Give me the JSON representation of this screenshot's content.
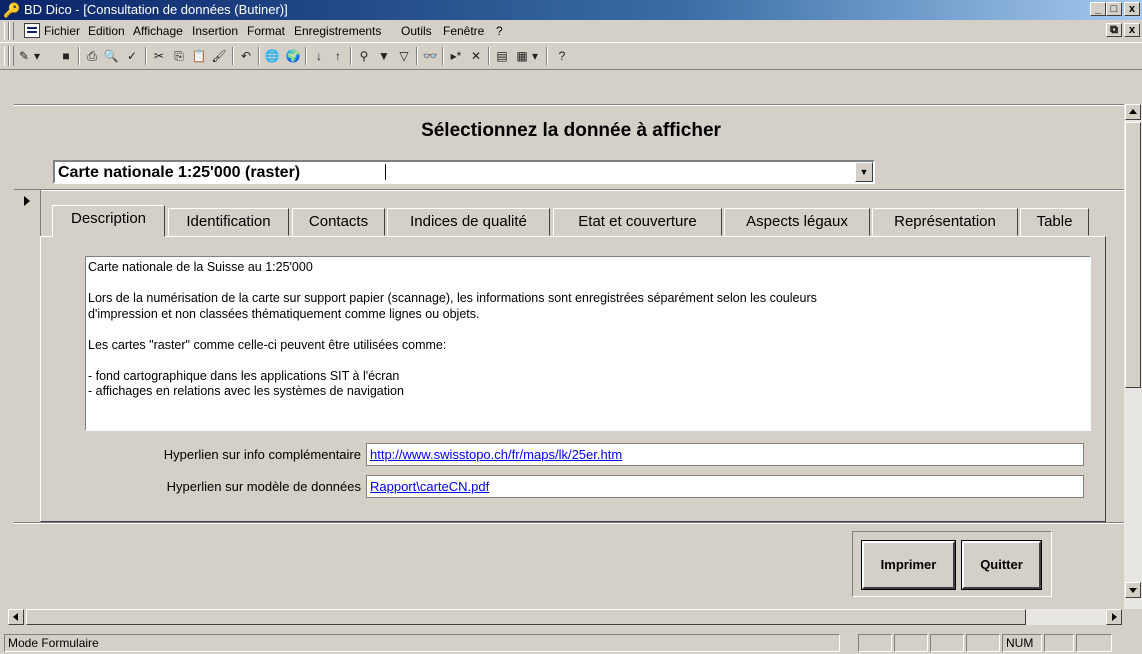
{
  "window": {
    "title": "BD Dico - [Consultation de données (Butiner)]",
    "controls": {
      "minimize": "_",
      "maximize": "□",
      "close": "x"
    },
    "doc_controls": {
      "restore": "⧉",
      "close": "x"
    }
  },
  "menu": [
    "Fichier",
    "Edition",
    "Affichage",
    "Insertion",
    "Format",
    "Enregistrements",
    "Outils",
    "Fenêtre",
    "?"
  ],
  "toolbar_icons": [
    "design-view-icon",
    "save-icon",
    "print-icon",
    "print-preview-icon",
    "spelling-icon",
    "cut-icon",
    "copy-icon",
    "paste-icon",
    "format-painter-icon",
    "undo-icon",
    "insert-hyperlink-icon",
    "web-toolbar-icon",
    "sort-ascending-icon",
    "sort-descending-icon",
    "filter-by-selection-icon",
    "filter-by-form-icon",
    "apply-filter-icon",
    "find-icon",
    "new-record-icon",
    "delete-record-icon",
    "database-window-icon",
    "new-object-icon",
    "help-icon"
  ],
  "form": {
    "heading": "Sélectionnez la donnée à afficher",
    "selector_value": "Carte nationale 1:25'000 (raster)",
    "tabs": [
      "Description",
      "Identification",
      "Contacts",
      "Indices de qualité",
      "Etat et couverture",
      "Aspects légaux",
      "Représentation",
      "Table"
    ],
    "active_tab": "Description",
    "description": "Carte nationale de la Suisse au 1:25'000\n\nLors de la numérisation de la carte sur support papier (scannage), les informations sont enregistrées séparément selon les couleurs\nd'impression et non classées thématiquement comme lignes ou objets.\n\nLes cartes \"raster\" comme celle-ci peuvent être utilisées comme:\n\n- fond cartographique dans les applications SIT à l'écran\n- affichages en relations avec les systèmes de navigation",
    "hyperlink_info_label": "Hyperlien sur info complémentaire",
    "hyperlink_info_value": "http://www.swisstopo.ch/fr/maps/lk/25er.htm",
    "hyperlink_model_label": "Hyperlien sur modèle de données",
    "hyperlink_model_value": "Rapport\\carteCN.pdf",
    "print_button": "Imprimer",
    "quit_button": "Quitter"
  },
  "status": {
    "mode": "Mode Formulaire",
    "num": "NUM"
  },
  "colors": {
    "titlebar_start": "#0a246a",
    "titlebar_end": "#a6caf0",
    "face": "#d4d0c8",
    "link": "#0000ff"
  }
}
